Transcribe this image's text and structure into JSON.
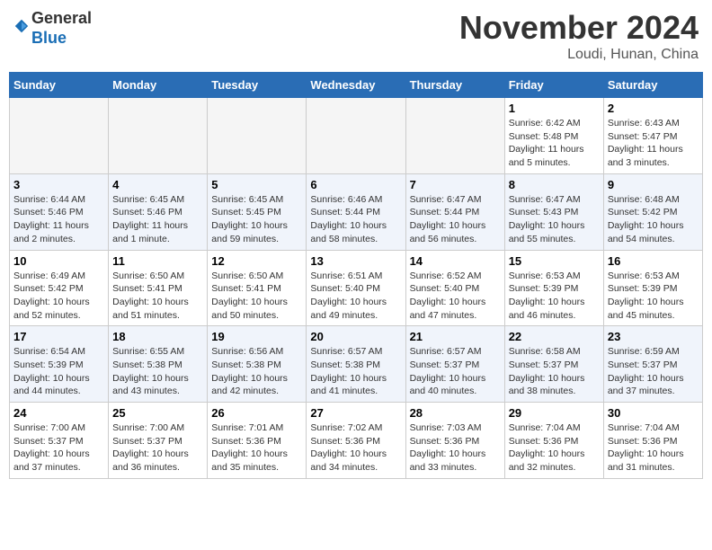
{
  "header": {
    "logo_line1": "General",
    "logo_line2": "Blue",
    "month_title": "November 2024",
    "location": "Loudi, Hunan, China"
  },
  "days_of_week": [
    "Sunday",
    "Monday",
    "Tuesday",
    "Wednesday",
    "Thursday",
    "Friday",
    "Saturday"
  ],
  "weeks": [
    {
      "days": [
        {
          "num": "",
          "info": ""
        },
        {
          "num": "",
          "info": ""
        },
        {
          "num": "",
          "info": ""
        },
        {
          "num": "",
          "info": ""
        },
        {
          "num": "",
          "info": ""
        },
        {
          "num": "1",
          "info": "Sunrise: 6:42 AM\nSunset: 5:48 PM\nDaylight: 11 hours and 5 minutes."
        },
        {
          "num": "2",
          "info": "Sunrise: 6:43 AM\nSunset: 5:47 PM\nDaylight: 11 hours and 3 minutes."
        }
      ]
    },
    {
      "days": [
        {
          "num": "3",
          "info": "Sunrise: 6:44 AM\nSunset: 5:46 PM\nDaylight: 11 hours and 2 minutes."
        },
        {
          "num": "4",
          "info": "Sunrise: 6:45 AM\nSunset: 5:46 PM\nDaylight: 11 hours and 1 minute."
        },
        {
          "num": "5",
          "info": "Sunrise: 6:45 AM\nSunset: 5:45 PM\nDaylight: 10 hours and 59 minutes."
        },
        {
          "num": "6",
          "info": "Sunrise: 6:46 AM\nSunset: 5:44 PM\nDaylight: 10 hours and 58 minutes."
        },
        {
          "num": "7",
          "info": "Sunrise: 6:47 AM\nSunset: 5:44 PM\nDaylight: 10 hours and 56 minutes."
        },
        {
          "num": "8",
          "info": "Sunrise: 6:47 AM\nSunset: 5:43 PM\nDaylight: 10 hours and 55 minutes."
        },
        {
          "num": "9",
          "info": "Sunrise: 6:48 AM\nSunset: 5:42 PM\nDaylight: 10 hours and 54 minutes."
        }
      ]
    },
    {
      "days": [
        {
          "num": "10",
          "info": "Sunrise: 6:49 AM\nSunset: 5:42 PM\nDaylight: 10 hours and 52 minutes."
        },
        {
          "num": "11",
          "info": "Sunrise: 6:50 AM\nSunset: 5:41 PM\nDaylight: 10 hours and 51 minutes."
        },
        {
          "num": "12",
          "info": "Sunrise: 6:50 AM\nSunset: 5:41 PM\nDaylight: 10 hours and 50 minutes."
        },
        {
          "num": "13",
          "info": "Sunrise: 6:51 AM\nSunset: 5:40 PM\nDaylight: 10 hours and 49 minutes."
        },
        {
          "num": "14",
          "info": "Sunrise: 6:52 AM\nSunset: 5:40 PM\nDaylight: 10 hours and 47 minutes."
        },
        {
          "num": "15",
          "info": "Sunrise: 6:53 AM\nSunset: 5:39 PM\nDaylight: 10 hours and 46 minutes."
        },
        {
          "num": "16",
          "info": "Sunrise: 6:53 AM\nSunset: 5:39 PM\nDaylight: 10 hours and 45 minutes."
        }
      ]
    },
    {
      "days": [
        {
          "num": "17",
          "info": "Sunrise: 6:54 AM\nSunset: 5:39 PM\nDaylight: 10 hours and 44 minutes."
        },
        {
          "num": "18",
          "info": "Sunrise: 6:55 AM\nSunset: 5:38 PM\nDaylight: 10 hours and 43 minutes."
        },
        {
          "num": "19",
          "info": "Sunrise: 6:56 AM\nSunset: 5:38 PM\nDaylight: 10 hours and 42 minutes."
        },
        {
          "num": "20",
          "info": "Sunrise: 6:57 AM\nSunset: 5:38 PM\nDaylight: 10 hours and 41 minutes."
        },
        {
          "num": "21",
          "info": "Sunrise: 6:57 AM\nSunset: 5:37 PM\nDaylight: 10 hours and 40 minutes."
        },
        {
          "num": "22",
          "info": "Sunrise: 6:58 AM\nSunset: 5:37 PM\nDaylight: 10 hours and 38 minutes."
        },
        {
          "num": "23",
          "info": "Sunrise: 6:59 AM\nSunset: 5:37 PM\nDaylight: 10 hours and 37 minutes."
        }
      ]
    },
    {
      "days": [
        {
          "num": "24",
          "info": "Sunrise: 7:00 AM\nSunset: 5:37 PM\nDaylight: 10 hours and 37 minutes."
        },
        {
          "num": "25",
          "info": "Sunrise: 7:00 AM\nSunset: 5:37 PM\nDaylight: 10 hours and 36 minutes."
        },
        {
          "num": "26",
          "info": "Sunrise: 7:01 AM\nSunset: 5:36 PM\nDaylight: 10 hours and 35 minutes."
        },
        {
          "num": "27",
          "info": "Sunrise: 7:02 AM\nSunset: 5:36 PM\nDaylight: 10 hours and 34 minutes."
        },
        {
          "num": "28",
          "info": "Sunrise: 7:03 AM\nSunset: 5:36 PM\nDaylight: 10 hours and 33 minutes."
        },
        {
          "num": "29",
          "info": "Sunrise: 7:04 AM\nSunset: 5:36 PM\nDaylight: 10 hours and 32 minutes."
        },
        {
          "num": "30",
          "info": "Sunrise: 7:04 AM\nSunset: 5:36 PM\nDaylight: 10 hours and 31 minutes."
        }
      ]
    }
  ]
}
